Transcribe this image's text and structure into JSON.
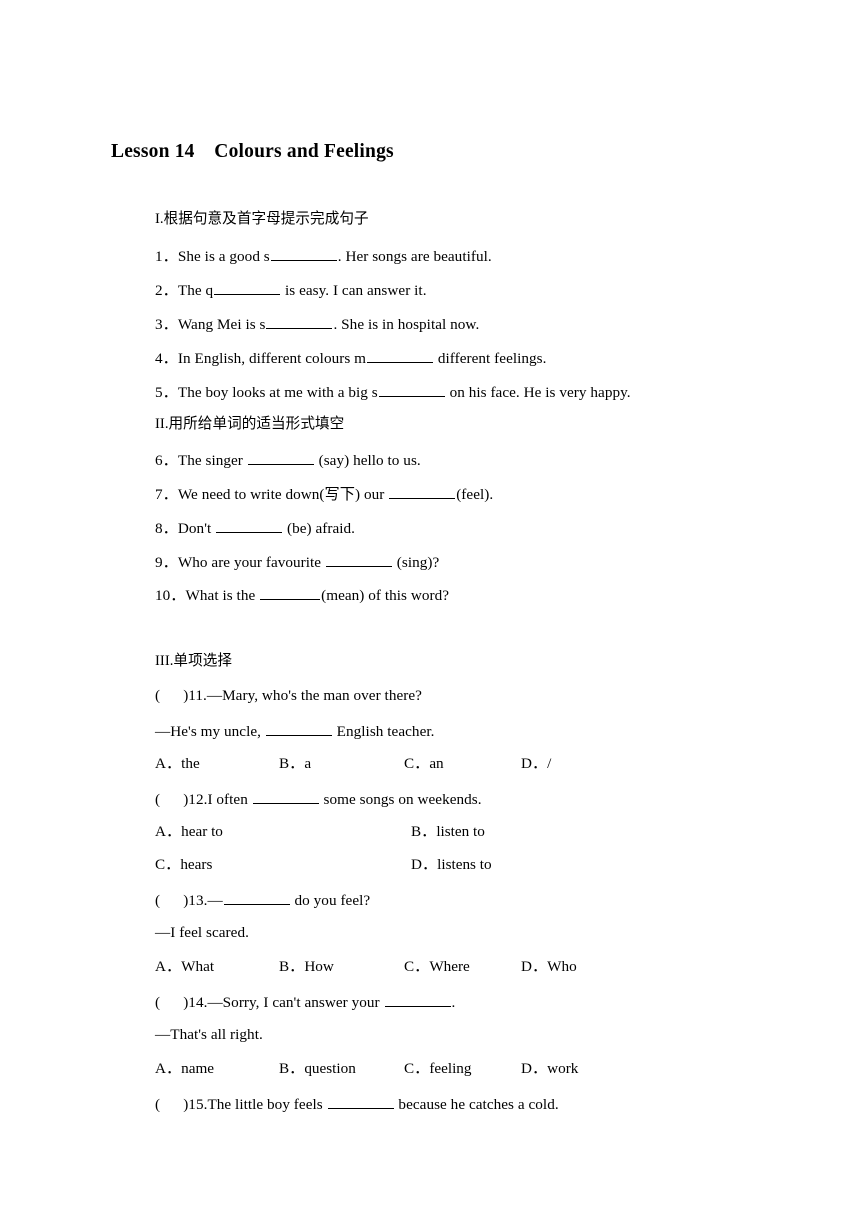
{
  "document": {
    "title": "Lesson 14　Colours and Feelings"
  },
  "sections": [
    {
      "id": "section-1",
      "heading": "I.根据句意及首字母提示完成句子",
      "items": [
        {
          "num": "1．",
          "pre": "She is a good s",
          "post": ". Her songs are beautiful.",
          "blank": "large"
        },
        {
          "num": "2．",
          "pre": "The q",
          "post": " is easy. I can answer it.",
          "blank": "large"
        },
        {
          "num": "3．",
          "pre": "Wang Mei is s",
          "post": ". She is in hospital now.",
          "blank": "large"
        },
        {
          "num": "4．",
          "pre": "In English, different colours m",
          "post": " different feelings.",
          "blank": "large"
        },
        {
          "num": "5．",
          "pre": "The boy looks at me with a big s",
          "post": " on his face. He is very happy.",
          "blank": "large"
        }
      ]
    },
    {
      "id": "section-2",
      "heading": "II.用所给单词的适当形式填空",
      "items": [
        {
          "num": "6．",
          "pre": "The singer ",
          "post": " (say) hello to us.",
          "blank": "large"
        },
        {
          "num": "7．",
          "pre": "We need to write down(写下) our ",
          "post": "(feel).",
          "blank": "large"
        },
        {
          "num": "8．",
          "pre": "Don't ",
          "post": " (be) afraid.",
          "blank": "large"
        },
        {
          "num": "9．",
          "pre": "Who are your favourite ",
          "post": " (sing)?",
          "blank": "large"
        },
        {
          "num": "10．",
          "pre": "What is the ",
          "post": "(mean) of this word?",
          "blank": "large"
        }
      ]
    },
    {
      "id": "section-3",
      "heading": "III.单项选择",
      "questions": [
        {
          "bracket": "(      )",
          "num": "11.",
          "stem_pre": "—Mary, who's the man over there?",
          "stem_post_pre": "—He's my uncle, ",
          "stem_post_post": " English teacher.",
          "layout": "four",
          "options": [
            "A．the",
            "B．a",
            "C．an",
            "D．/"
          ]
        },
        {
          "bracket": "(      )",
          "num": "12.",
          "stem_pre": "I often ",
          "stem_pre_tail": " some songs on weekends.",
          "layout": "two",
          "options": [
            "A．hear to",
            "B．listen to",
            "C．hears",
            "D．listens to"
          ]
        },
        {
          "bracket": "(      )",
          "num": "13.",
          "stem_pre": "—",
          "stem_pre_tail": " do you feel?",
          "stem_post": "—I feel scared.",
          "layout": "four",
          "options": [
            "A．What",
            "B．How",
            "C．Where",
            "D．Who"
          ]
        },
        {
          "bracket": "(      )",
          "num": "14.",
          "stem_pre": "—Sorry, I can't answer your ",
          "stem_pre_tail": ".",
          "stem_post": "—That's all right.",
          "layout": "four",
          "options": [
            "A．name",
            "B．question",
            "C．feeling",
            "D．work"
          ]
        },
        {
          "bracket": "(      )",
          "num": "15.",
          "stem_pre": "The little boy feels ",
          "stem_pre_tail": " because he catches a cold.",
          "layout": "none",
          "options": []
        }
      ]
    }
  ]
}
